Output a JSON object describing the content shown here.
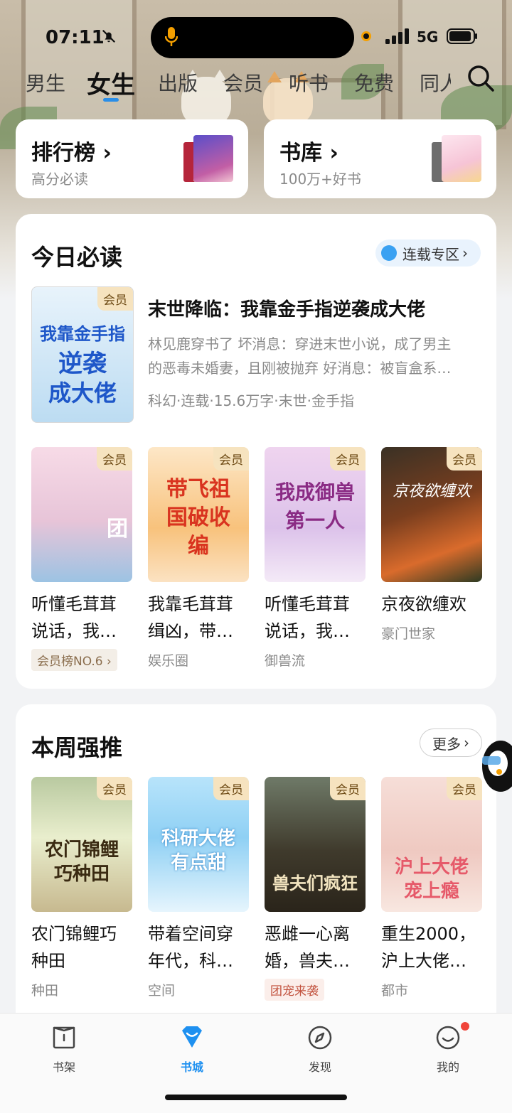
{
  "status": {
    "time": "07:11",
    "network": "5G"
  },
  "tabs": [
    {
      "label": "男生"
    },
    {
      "label": "女生"
    },
    {
      "label": "出版"
    },
    {
      "label": "会员"
    },
    {
      "label": "听书"
    },
    {
      "label": "免费"
    },
    {
      "label": "同人"
    }
  ],
  "quick": {
    "ranking": {
      "title": "排行榜",
      "sub": "高分必读"
    },
    "library": {
      "title": "书库",
      "sub": "100万+好书"
    }
  },
  "today": {
    "title": "今日必读",
    "link": "连载专区",
    "featured": {
      "badge": "会员",
      "title": "末世降临：我靠金手指逆袭成大佬",
      "desc_line1": "林见鹿穿书了 坏消息：穿进末世小说，成了男主",
      "desc_line2": "的恶毒未婚妻，且刚被抛弃 好消息：被盲盒系…",
      "meta": "科幻·连载·15.6万字·末世·金手指",
      "cover_text_1": "我靠金手指",
      "cover_text_2": "逆袭",
      "cover_text_3": "成大佬"
    },
    "books": [
      {
        "badge": "会员",
        "line1": "听懂毛茸茸",
        "line2": "说话，我…",
        "tag": "会员榜NO.6",
        "cover_text": "团"
      },
      {
        "badge": "会员",
        "line1": "我靠毛茸茸",
        "line2": "缉凶，带…",
        "tag": "娱乐圈",
        "cover_text": "带飞祖国破收编"
      },
      {
        "badge": "会员",
        "line1": "听懂毛茸茸",
        "line2": "说话，我…",
        "tag": "御兽流",
        "cover_text": "我成御兽第一人"
      },
      {
        "badge": "会员",
        "line1": "京夜欲缠欢",
        "line2": "",
        "tag": "豪门世家",
        "cover_text": "京夜欲缠欢"
      }
    ]
  },
  "weekly": {
    "title": "本周强推",
    "more": "更多",
    "books": [
      {
        "badge": "会员",
        "line1": "农门锦鲤巧",
        "line2": "种田",
        "tag": "种田",
        "cover_text": "农门锦鲤巧种田"
      },
      {
        "badge": "会员",
        "line1": "带着空间穿",
        "line2": "年代，科…",
        "tag": "空间",
        "cover_text": "科研大佬有点甜"
      },
      {
        "badge": "会员",
        "line1": "恶雌一心离",
        "line2": "婚，兽夫…",
        "tag": "团宠来袭",
        "cover_text": "兽夫们疯狂"
      },
      {
        "badge": "会员",
        "line1": "重生2000，",
        "line2": "沪上大佬…",
        "tag": "都市",
        "cover_text": "沪上大佬宠上瘾"
      }
    ]
  },
  "nav": [
    {
      "label": "书架",
      "icon": "bookshelf-icon"
    },
    {
      "label": "书城",
      "icon": "bookstore-icon"
    },
    {
      "label": "发现",
      "icon": "compass-icon"
    },
    {
      "label": "我的",
      "icon": "profile-icon"
    }
  ],
  "colors": {
    "accent": "#1e90f0",
    "badge_bg": "#f6e3bf",
    "page_bg": "#f2f3f5"
  }
}
